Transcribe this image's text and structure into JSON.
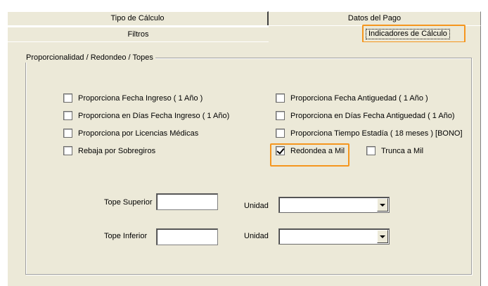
{
  "tabs": {
    "row1": [
      {
        "label": "Tipo de Cálculo"
      },
      {
        "label": "Datos del Pago"
      }
    ],
    "row2": [
      {
        "label": "Filtros"
      },
      {
        "label": "Indicadores de Cálculo",
        "active": true
      }
    ]
  },
  "group": {
    "title": "Proporcionalidad / Redondeo / Topes"
  },
  "checkboxes": [
    {
      "label": "Proporciona Fecha Ingreso ( 1 Año )",
      "checked": false
    },
    {
      "label": "Proporciona Fecha Antiguedad ( 1 Año )",
      "checked": false
    },
    {
      "label": "Proporciona en Días Fecha Ingreso ( 1 Año)",
      "checked": false
    },
    {
      "label": "Proporciona en Días Fecha Antiguedad ( 1 Año)",
      "checked": false
    },
    {
      "label": "Proporciona por Licencias Médicas",
      "checked": false
    },
    {
      "label": "Proporciona Tiempo Estadía ( 18 meses ) [BONO]",
      "checked": false
    },
    {
      "label": "Rebaja por Sobregiros",
      "checked": false
    },
    {
      "label": "Redondea a Mil",
      "checked": true
    },
    {
      "label": "Trunca a Mil",
      "checked": false
    }
  ],
  "topes": {
    "superior": {
      "label": "Tope Superior",
      "value": "",
      "unit_label": "Unidad",
      "unit_value": ""
    },
    "inferior": {
      "label": "Tope Inferior",
      "value": "",
      "unit_label": "Unidad",
      "unit_value": ""
    }
  },
  "colors": {
    "highlight": "#f5961e",
    "panel": "#ece9d8"
  }
}
